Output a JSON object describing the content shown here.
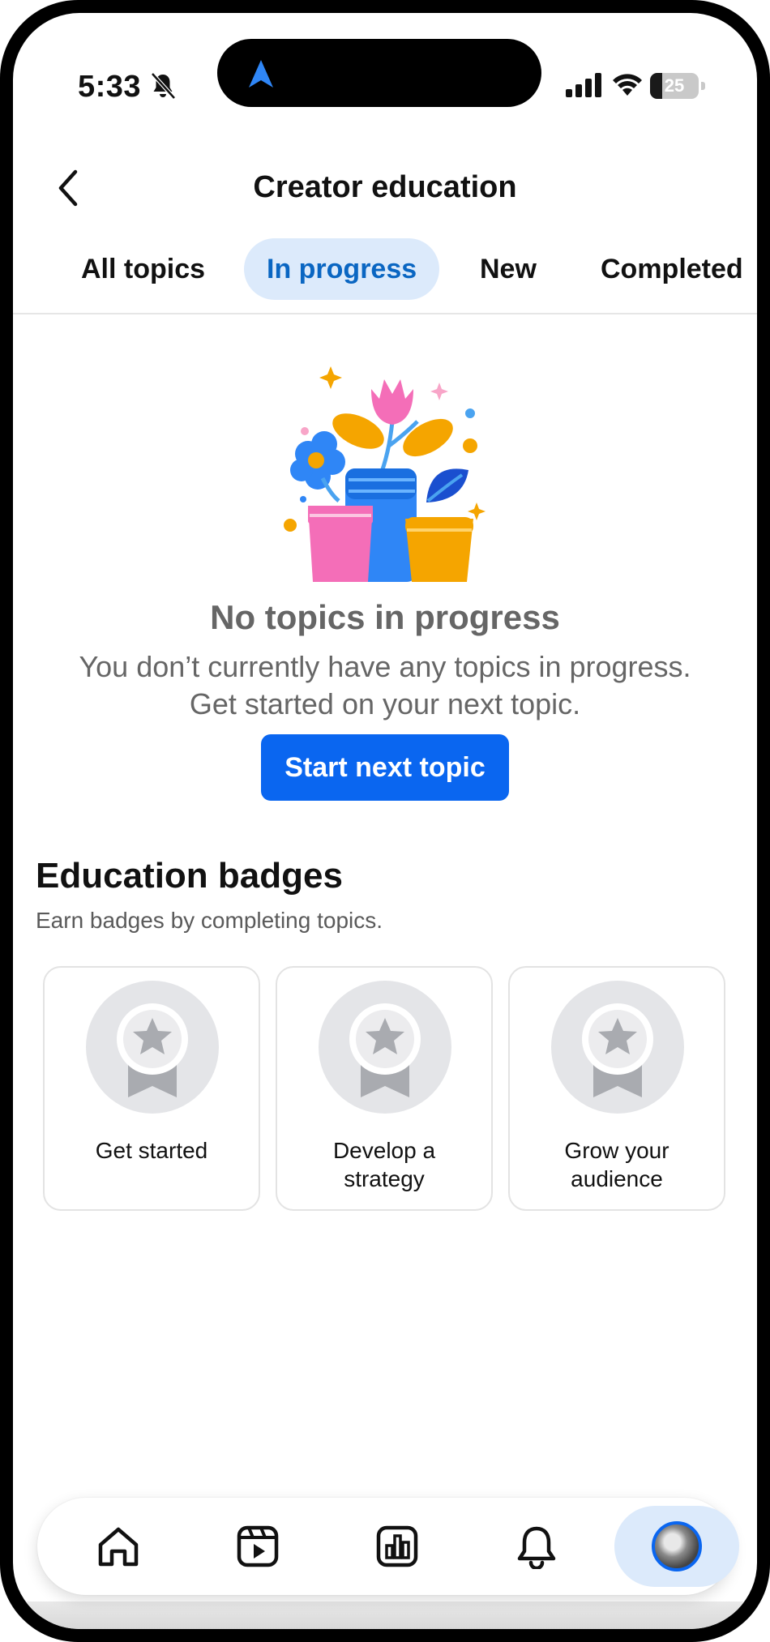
{
  "status_bar": {
    "time": "5:33",
    "battery_percent": "25",
    "battery_level": 0.25
  },
  "header": {
    "title": "Creator education",
    "back_icon": "chevron-left-icon"
  },
  "tabs": [
    {
      "label": "All topics",
      "active": false
    },
    {
      "label": "In progress",
      "active": true
    },
    {
      "label": "New",
      "active": false
    },
    {
      "label": "Completed",
      "active": false
    }
  ],
  "empty_state": {
    "title": "No topics in progress",
    "description_line1": "You don’t currently have any topics in progress.",
    "description_line2": "Get started on your next topic.",
    "button_label": "Start next topic"
  },
  "badges_section": {
    "title": "Education badges",
    "subtitle": "Earn badges by completing topics.",
    "badges": [
      {
        "label_line1": "Get started",
        "label_line2": "",
        "icon": "medal-icon"
      },
      {
        "label_line1": "Develop a",
        "label_line2": "strategy",
        "icon": "medal-icon"
      },
      {
        "label_line1": "Grow your",
        "label_line2": "audience",
        "icon": "medal-icon"
      }
    ]
  },
  "bottom_nav": {
    "items": [
      "home-icon",
      "video-icon",
      "analytics-icon",
      "notifications-icon",
      "profile-avatar"
    ]
  },
  "colors": {
    "accent": "#0a66f0",
    "tab_active_bg": "#dceafb",
    "tab_active_text": "#0a66c2"
  }
}
